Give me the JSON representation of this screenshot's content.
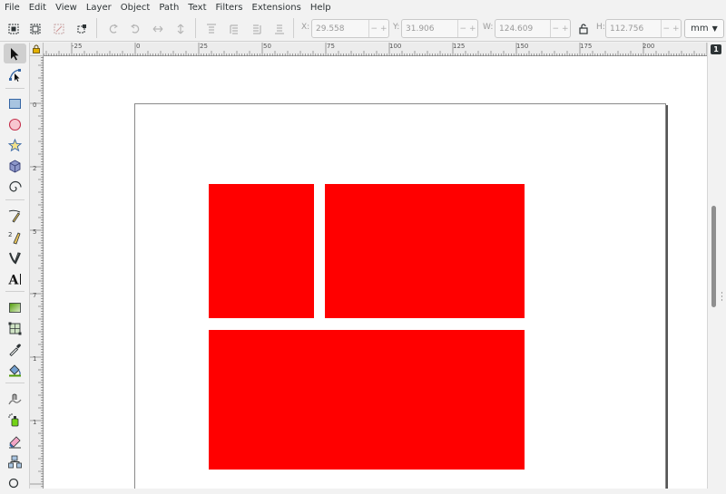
{
  "menubar": {
    "items": [
      "File",
      "Edit",
      "View",
      "Layer",
      "Object",
      "Path",
      "Text",
      "Filters",
      "Extensions",
      "Help"
    ]
  },
  "toolbar": {
    "x_label": "X:",
    "x_value": "29.558",
    "y_label": "Y:",
    "y_value": "31.906",
    "w_label": "W:",
    "w_value": "124.609",
    "h_label": "H:",
    "h_value": "112.756",
    "unit": "mm"
  },
  "ruler": {
    "h_labels": [
      "-25",
      "0",
      "25",
      "50",
      "75",
      "100",
      "125",
      "150",
      "175",
      "200"
    ],
    "v_labels": [
      "0",
      "2",
      "5",
      "7",
      "1",
      "1"
    ],
    "snap_badge": "1"
  },
  "tools": [
    "selector-tool",
    "node-tool",
    "rectangle-tool",
    "ellipse-tool",
    "star-tool",
    "3d-box-tool",
    "spiral-tool",
    "pencil-tool",
    "pen-tool",
    "calligraphy-tool",
    "text-tool",
    "gradient-tool",
    "mesh-tool",
    "dropper-tool",
    "paint-bucket-tool",
    "tweak-tool",
    "spray-tool",
    "eraser-tool",
    "connector-tool"
  ],
  "colors": {
    "shape_fill": "#ff0000",
    "canvas": "#ffffff",
    "chrome": "#f2f2f2"
  },
  "canvas": {
    "shapes": [
      "red-rectangle-top-left",
      "red-rectangle-top-right",
      "red-rectangle-bottom"
    ]
  }
}
